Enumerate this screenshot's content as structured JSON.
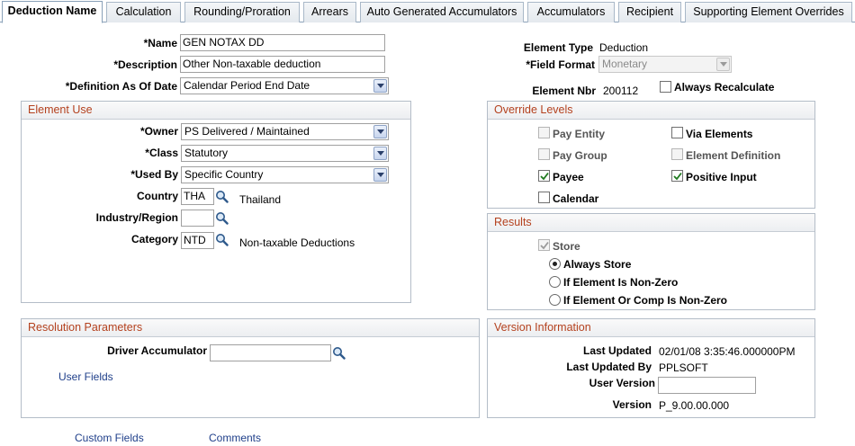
{
  "tabs": [
    {
      "label": "Deduction Name",
      "active": true
    },
    {
      "label": "Calculation"
    },
    {
      "label": "Rounding/Proration"
    },
    {
      "label": "Arrears"
    },
    {
      "label": "Auto Generated Accumulators"
    },
    {
      "label": "Accumulators"
    },
    {
      "label": "Recipient"
    },
    {
      "label": "Supporting Element Overrides"
    }
  ],
  "header": {
    "name_label": "*Name",
    "name_value": "GEN NOTAX DD",
    "description_label": "*Description",
    "description_value": "Other Non-taxable deduction",
    "definition_label": "*Definition As Of Date",
    "definition_value": "Calendar Period End Date",
    "element_type_label": "Element Type",
    "element_type_value": "Deduction",
    "field_format_label": "*Field Format",
    "field_format_value": "Monetary",
    "element_nbr_label": "Element Nbr",
    "element_nbr_value": "200112",
    "always_recalculate_label": "Always Recalculate",
    "always_recalculate_checked": false
  },
  "element_use": {
    "title": "Element Use",
    "owner_label": "*Owner",
    "owner_value": "PS Delivered / Maintained",
    "class_label": "*Class",
    "class_value": "Statutory",
    "used_by_label": "*Used By",
    "used_by_value": "Specific Country",
    "country_label": "Country",
    "country_code": "THA",
    "country_desc": "Thailand",
    "industry_label": "Industry/Region",
    "industry_value": "",
    "category_label": "Category",
    "category_code": "NTD",
    "category_desc": "Non-taxable Deductions"
  },
  "override_levels": {
    "title": "Override Levels",
    "items": [
      {
        "label": "Pay Entity",
        "checked": false,
        "enabled": false
      },
      {
        "label": "Via Elements",
        "checked": false,
        "enabled": true
      },
      {
        "label": "Pay Group",
        "checked": false,
        "enabled": false
      },
      {
        "label": "Element Definition",
        "checked": false,
        "enabled": false
      },
      {
        "label": "Payee",
        "checked": true,
        "enabled": true
      },
      {
        "label": "Positive Input",
        "checked": true,
        "enabled": true
      },
      {
        "label": "Calendar",
        "checked": false,
        "enabled": true
      }
    ]
  },
  "results": {
    "title": "Results",
    "store_label": "Store",
    "store_checked": true,
    "options": [
      {
        "label": "Always Store",
        "selected": true
      },
      {
        "label": "If Element Is Non-Zero",
        "selected": false
      },
      {
        "label": "If Element Or Comp Is Non-Zero",
        "selected": false
      }
    ]
  },
  "resolution": {
    "title": "Resolution Parameters",
    "driver_label": "Driver Accumulator",
    "driver_value": "",
    "user_fields_link": "User Fields"
  },
  "version": {
    "title": "Version Information",
    "last_updated_label": "Last Updated",
    "last_updated_value": "02/01/08  3:35:46.000000PM",
    "last_updated_by_label": "Last Updated By",
    "last_updated_by_value": "PPLSOFT",
    "user_version_label": "User Version",
    "user_version_value": "",
    "version_label": "Version",
    "version_value": "P_9.00.00.000"
  },
  "footer": {
    "custom_fields_link": "Custom Fields",
    "comments_link": "Comments"
  }
}
